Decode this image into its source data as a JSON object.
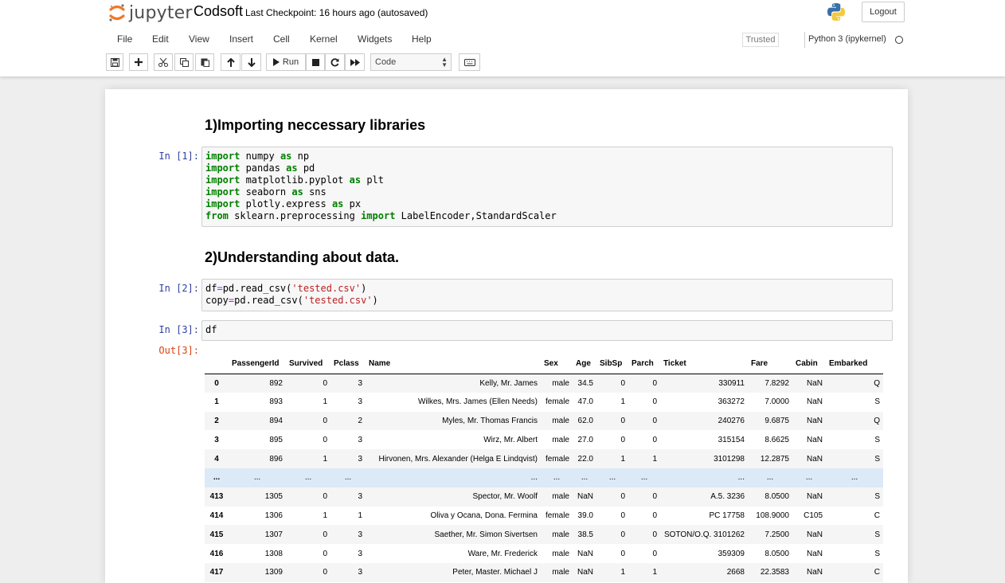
{
  "header": {
    "logo_text": "jupyter",
    "notebook_name": "Codsoft",
    "checkpoint": "Last Checkpoint: 16 hours ago",
    "autosave": "(autosaved)",
    "logout": "Logout"
  },
  "menu": [
    "File",
    "Edit",
    "View",
    "Insert",
    "Cell",
    "Kernel",
    "Widgets",
    "Help"
  ],
  "status": {
    "trusted": "Trusted",
    "kernel": "Python 3 (ipykernel)"
  },
  "toolbar": {
    "run_label": "Run",
    "cell_type": "Code"
  },
  "cells": {
    "heading1": "1)Importing neccessary libraries",
    "in1_prompt": "In [1]:",
    "heading2": "2)Understanding about data.",
    "in2_prompt": "In [2]:",
    "in3_prompt": "In [3]:",
    "in3_code": "df",
    "out3_prompt": "Out[3]:"
  },
  "dataframe": {
    "columns": [
      "",
      "PassengerId",
      "Survived",
      "Pclass",
      "Name",
      "Sex",
      "Age",
      "SibSp",
      "Parch",
      "Ticket",
      "Fare",
      "Cabin",
      "Embarked"
    ],
    "rows": [
      [
        "0",
        "892",
        "0",
        "3",
        "Kelly, Mr. James",
        "male",
        "34.5",
        "0",
        "0",
        "330911",
        "7.8292",
        "NaN",
        "Q"
      ],
      [
        "1",
        "893",
        "1",
        "3",
        "Wilkes, Mrs. James (Ellen Needs)",
        "female",
        "47.0",
        "1",
        "0",
        "363272",
        "7.0000",
        "NaN",
        "S"
      ],
      [
        "2",
        "894",
        "0",
        "2",
        "Myles, Mr. Thomas Francis",
        "male",
        "62.0",
        "0",
        "0",
        "240276",
        "9.6875",
        "NaN",
        "Q"
      ],
      [
        "3",
        "895",
        "0",
        "3",
        "Wirz, Mr. Albert",
        "male",
        "27.0",
        "0",
        "0",
        "315154",
        "8.6625",
        "NaN",
        "S"
      ],
      [
        "4",
        "896",
        "1",
        "3",
        "Hirvonen, Mrs. Alexander (Helga E Lindqvist)",
        "female",
        "22.0",
        "1",
        "1",
        "3101298",
        "12.2875",
        "NaN",
        "S"
      ],
      [
        "...",
        "...",
        "...",
        "...",
        "...",
        "...",
        "...",
        "...",
        "...",
        "...",
        "...",
        "...",
        "..."
      ],
      [
        "413",
        "1305",
        "0",
        "3",
        "Spector, Mr. Woolf",
        "male",
        "NaN",
        "0",
        "0",
        "A.5. 3236",
        "8.0500",
        "NaN",
        "S"
      ],
      [
        "414",
        "1306",
        "1",
        "1",
        "Oliva y Ocana, Dona. Fermina",
        "female",
        "39.0",
        "0",
        "0",
        "PC 17758",
        "108.9000",
        "C105",
        "C"
      ],
      [
        "415",
        "1307",
        "0",
        "3",
        "Saether, Mr. Simon Sivertsen",
        "male",
        "38.5",
        "0",
        "0",
        "SOTON/O.Q. 3101262",
        "7.2500",
        "NaN",
        "S"
      ],
      [
        "416",
        "1308",
        "0",
        "3",
        "Ware, Mr. Frederick",
        "male",
        "NaN",
        "0",
        "0",
        "359309",
        "8.0500",
        "NaN",
        "S"
      ],
      [
        "417",
        "1309",
        "0",
        "3",
        "Peter, Master. Michael J",
        "male",
        "NaN",
        "1",
        "1",
        "2668",
        "22.3583",
        "NaN",
        "C"
      ]
    ]
  },
  "colors": {
    "prompt_in": "#303f9f",
    "prompt_out": "#d84315",
    "keyword": "#008000",
    "string": "#ba2121",
    "operator": "#aa22ff",
    "jupyter_orange": "#f37726"
  }
}
